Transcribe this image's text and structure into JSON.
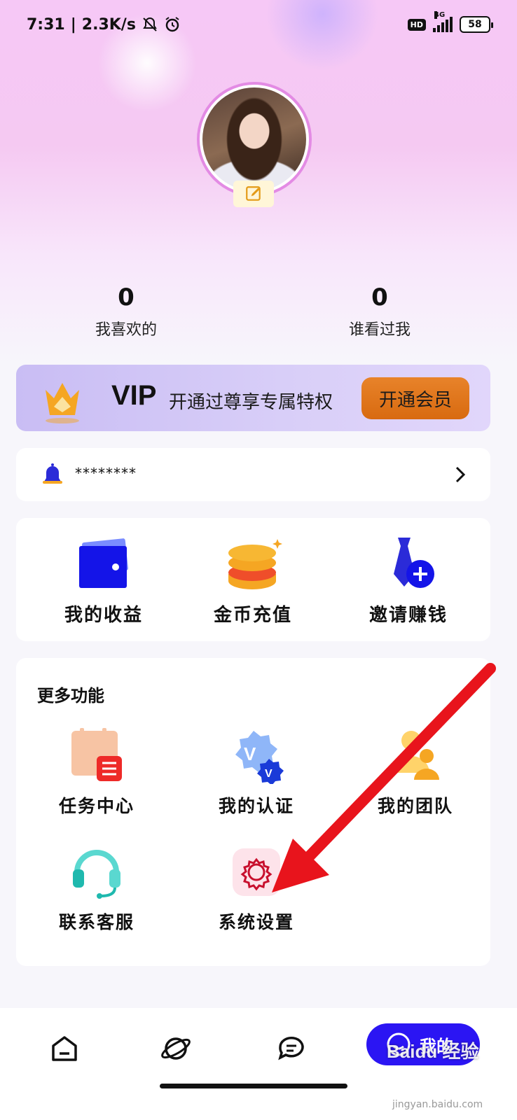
{
  "status_bar": {
    "time": "7:31",
    "separator": "|",
    "net_speed": "2.3K/s",
    "hd": "HD",
    "network": "4G",
    "battery": "58"
  },
  "profile": {
    "stats": [
      {
        "value": "0",
        "label": "我喜欢的"
      },
      {
        "value": "0",
        "label": "谁看过我"
      }
    ]
  },
  "vip": {
    "title": "VIP",
    "description": "开通过尊享专属特权",
    "button": "开通会员"
  },
  "notice": {
    "text": "********"
  },
  "quick_actions": [
    {
      "label": "我的收益",
      "icon": "wallet-icon"
    },
    {
      "label": "金币充值",
      "icon": "coins-icon"
    },
    {
      "label": "邀请赚钱",
      "icon": "invite-tie-icon"
    }
  ],
  "more": {
    "title": "更多功能",
    "items": [
      {
        "label": "任务中心",
        "icon": "task-calendar-icon"
      },
      {
        "label": "我的认证",
        "icon": "verified-badge-icon"
      },
      {
        "label": "我的团队",
        "icon": "team-icon"
      },
      {
        "label": "联系客服",
        "icon": "headset-icon"
      },
      {
        "label": "系统设置",
        "icon": "gear-icon"
      }
    ]
  },
  "tab_bar": {
    "active_label": "我的",
    "tabs": [
      "home-icon",
      "planet-icon",
      "chat-icon",
      "smile-icon"
    ]
  },
  "watermark": {
    "main": "Baidu 经验",
    "sub": "jingyan.baidu.com"
  },
  "colors": {
    "accent": "#2b15f3",
    "vip_button": "#e07a20",
    "arrow": "#e8141c"
  }
}
